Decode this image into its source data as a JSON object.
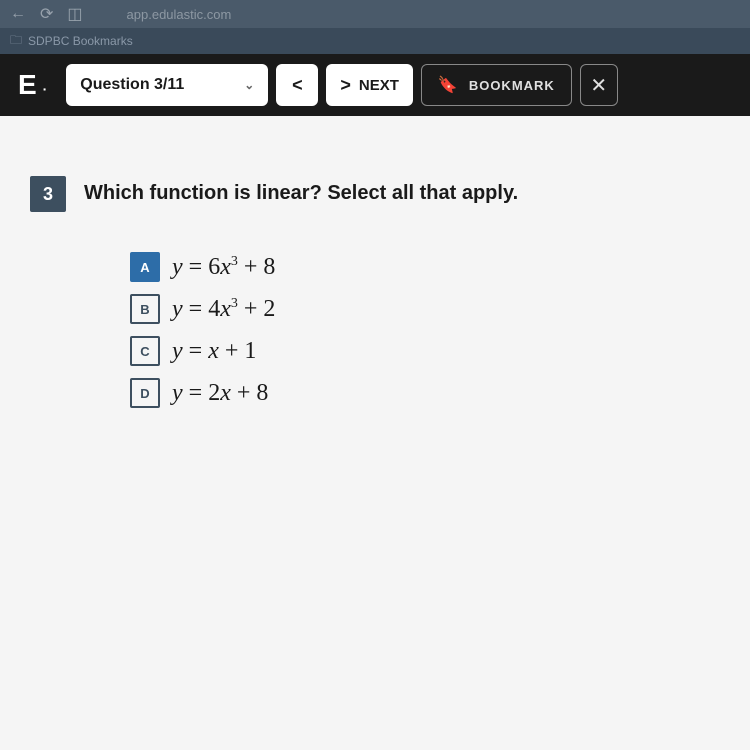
{
  "browser": {
    "url_hint": "app.edulastic.com",
    "bookmark_folder": "SDPBC Bookmarks"
  },
  "toolbar": {
    "logo": "E",
    "question_selector": "Question 3/11",
    "next_label": "NEXT",
    "bookmark_label": "BOOKMARK"
  },
  "question": {
    "number": "3",
    "text": "Which function is linear? Select all that apply."
  },
  "choices": [
    {
      "letter": "A",
      "plain": "y = 6x^3 + 8",
      "selected": true
    },
    {
      "letter": "B",
      "plain": "y = 4x^3 + 2",
      "selected": false
    },
    {
      "letter": "C",
      "plain": "y = x + 1",
      "selected": false
    },
    {
      "letter": "D",
      "plain": "y = 2x + 8",
      "selected": false
    }
  ],
  "choice_html": {
    "A": "y <span class='rm'>= 6</span>x<sup>3</sup> <span class='rm'>+ 8</span>",
    "B": "y <span class='rm'>= 4</span>x<sup>3</sup> <span class='rm'>+ 2</span>",
    "C": "y <span class='rm'>= </span>x <span class='rm'>+ 1</span>",
    "D": "y <span class='rm'>= 2</span>x <span class='rm'>+ 8</span>"
  }
}
